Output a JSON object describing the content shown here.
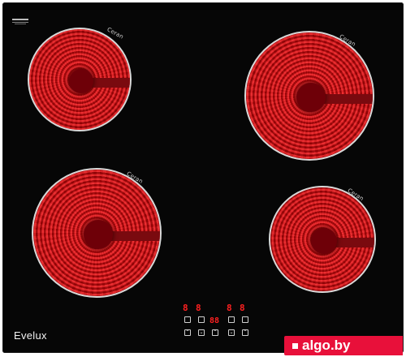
{
  "product": {
    "brand": "Evelux",
    "burner_labels": [
      "Ceran",
      "Ceran",
      "Ceran",
      "Ceran"
    ],
    "display": {
      "left_digits": [
        "8",
        "8"
      ],
      "center_digits": "88",
      "right_digits": [
        "8",
        "8"
      ],
      "keys": [
        "⌃",
        "⌄",
        "⌃",
        "⌄",
        "⌃",
        "⌄",
        "⏻"
      ]
    }
  },
  "watermark": {
    "text": "algo.by"
  },
  "colors": {
    "glass": "#060606",
    "heat": "#c80a12",
    "ring": "#d8d8d8",
    "display": "#ff2020",
    "watermark_bg": "#e8103a"
  },
  "icons": [
    "power-icon",
    "plus-icon",
    "minus-icon"
  ]
}
